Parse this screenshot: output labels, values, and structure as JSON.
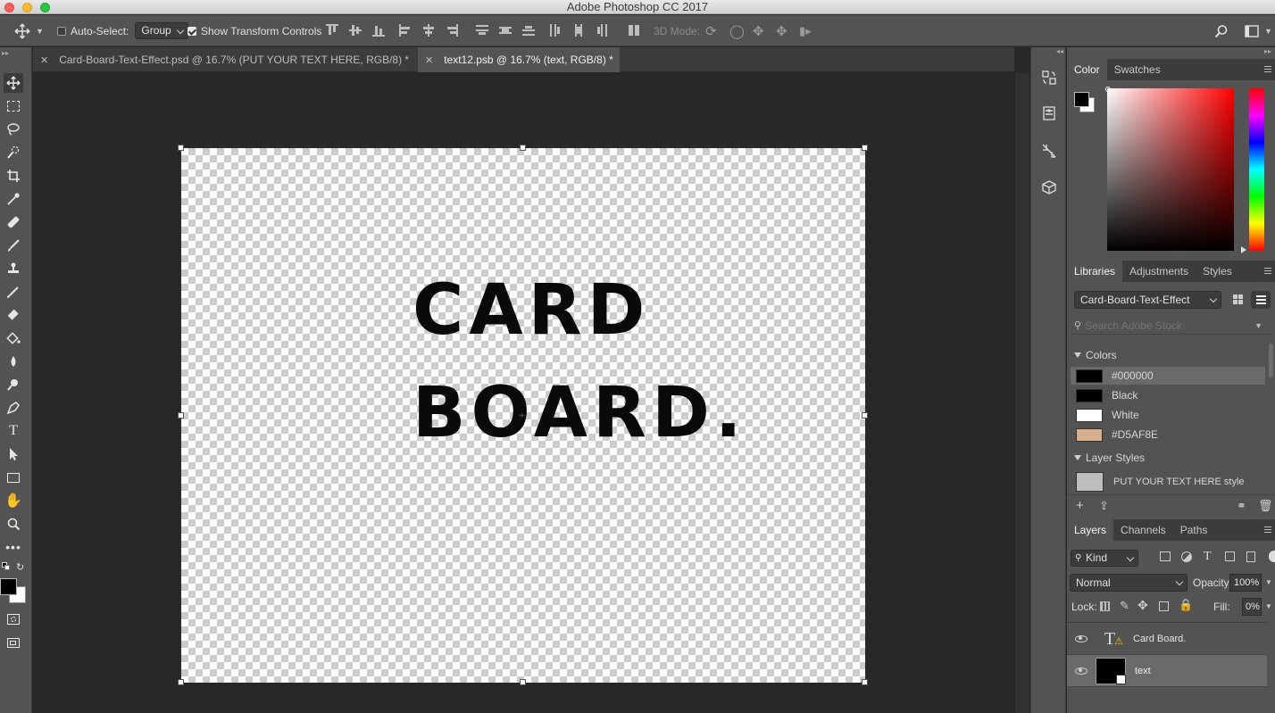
{
  "app": {
    "title": "Adobe Photoshop CC 2017"
  },
  "options_bar": {
    "auto_select_label": "Auto-Select:",
    "auto_select_value": "Group",
    "show_transform_label": "Show Transform Controls",
    "mode_3d_label": "3D Mode:"
  },
  "doc_tabs": [
    {
      "label": "Card-Board-Text-Effect.psd @ 16.7% (PUT YOUR TEXT HERE, RGB/8) *"
    },
    {
      "label": "text12.psb @ 16.7% (text, RGB/8) *"
    }
  ],
  "canvas": {
    "line1": "CARD",
    "line2": "BOARD."
  },
  "color_panel": {
    "tabs": [
      "Color",
      "Swatches"
    ],
    "foreground": "#000000",
    "background": "#ffffff"
  },
  "libraries_panel": {
    "tabs": [
      "Libraries",
      "Adjustments",
      "Styles"
    ],
    "library_select": "Card-Board-Text-Effect",
    "search_placeholder": "Search Adobe Stock",
    "colors_header": "Colors",
    "colors": [
      {
        "label": "#000000",
        "hex": "#000000"
      },
      {
        "label": "Black",
        "hex": "#000000"
      },
      {
        "label": "White",
        "hex": "#ffffff"
      },
      {
        "label": "#D5AF8E",
        "hex": "#D5AF8E"
      }
    ],
    "layer_styles_header": "Layer Styles",
    "layer_style_item": "PUT YOUR TEXT HERE style"
  },
  "layers_panel": {
    "tabs": [
      "Layers",
      "Channels",
      "Paths"
    ],
    "filter_select": "Kind",
    "blend_mode": "Normal",
    "opacity_label": "Opacity:",
    "opacity_value": "100%",
    "lock_label": "Lock:",
    "fill_label": "Fill:",
    "fill_value": "0%",
    "layers": [
      {
        "name": "Card Board."
      },
      {
        "name": "text"
      }
    ]
  }
}
